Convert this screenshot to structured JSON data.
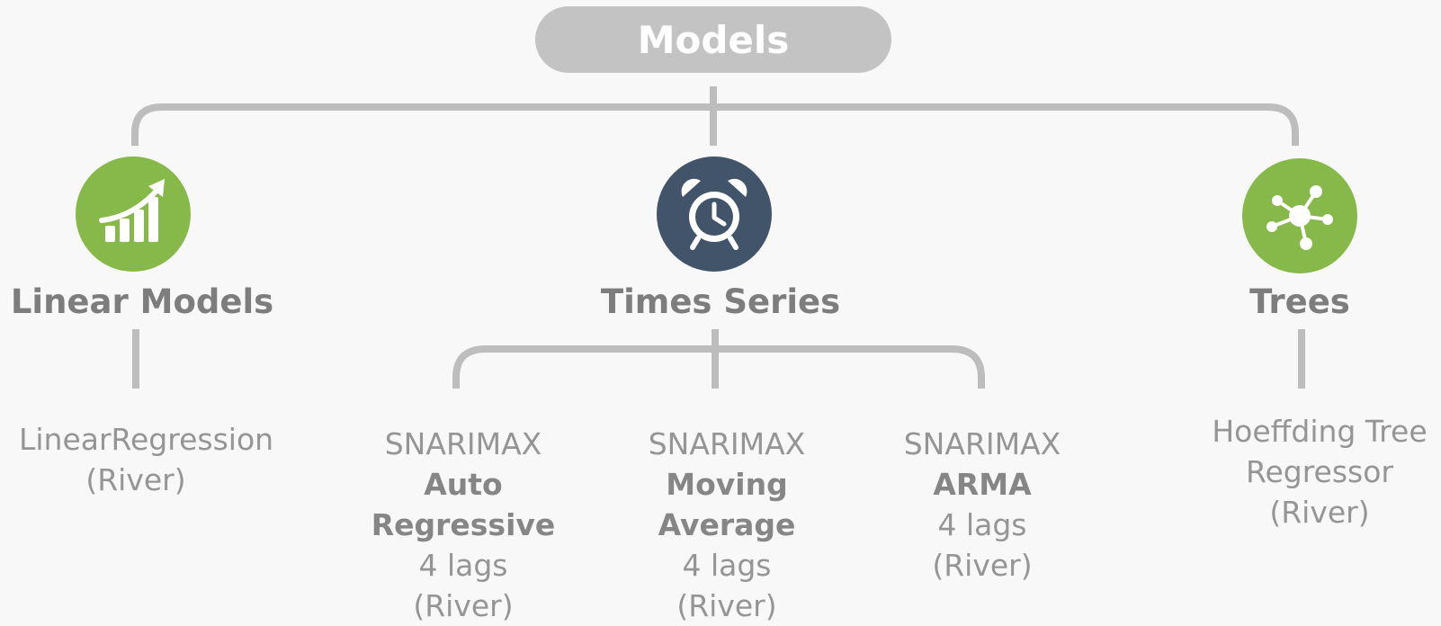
{
  "root": {
    "label": "Models"
  },
  "colors": {
    "green": "#86b84a",
    "navy": "#425469",
    "connector": "#bdbdbd",
    "root_fill": "#c4c3c3"
  },
  "categories": [
    {
      "title": "Linear Models",
      "icon": "growth-chart-icon",
      "leaves": [
        {
          "lines": [
            "LinearRegression",
            "(River)"
          ]
        }
      ]
    },
    {
      "title": "Times Series",
      "icon": "alarm-clock-icon",
      "leaves": [
        {
          "lines": [
            "SNARIMAX",
            "Auto",
            "Regressive",
            "4 lags",
            "(River)"
          ]
        },
        {
          "lines": [
            "SNARIMAX",
            "Moving",
            "Average",
            "4 lags",
            "(River)"
          ]
        },
        {
          "lines": [
            "SNARIMAX",
            "ARMA",
            "4 lags",
            "(River)"
          ]
        }
      ]
    },
    {
      "title": "Trees",
      "icon": "network-hub-icon",
      "leaves": [
        {
          "lines": [
            "Hoeffding Tree",
            "Regressor",
            "(River)"
          ]
        }
      ]
    }
  ]
}
